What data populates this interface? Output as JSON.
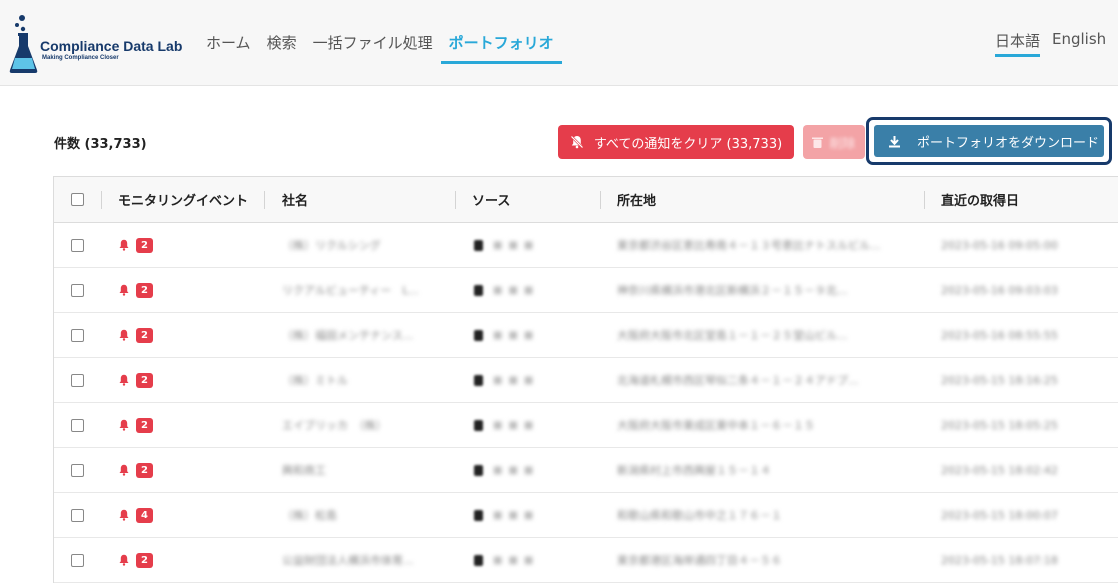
{
  "header": {
    "logo_title": "Compliance Data Lab",
    "logo_subtitle": "Making Compliance Closer",
    "nav": [
      "ホーム",
      "検索",
      "一括ファイル処理",
      "ポートフォリオ"
    ],
    "active_nav": "ポートフォリオ",
    "lang_ja": "日本語",
    "lang_en": "English"
  },
  "toolbar": {
    "count_label": "件数 (33,733)",
    "clear_button": "すべての通知をクリア (33,733)",
    "delete_button": "削除",
    "download_button": "ポートフォリオをダウンロード"
  },
  "table": {
    "headers": {
      "event": "モニタリングイベント",
      "company": "社名",
      "source": "ソース",
      "address": "所在地",
      "date": "直近の取得日"
    },
    "rows": [
      {
        "badge": "2",
        "company": "（株）リクルシング",
        "address": "東京都渋谷区恵比寿南４－１３号恵比ナトスルビル...",
        "date": "2023-05-16 09:05:00"
      },
      {
        "badge": "2",
        "company": "リクアルビューティー　L...",
        "address": "神奈川県横浜市港北区新横浜２－１５－９北...",
        "date": "2023-05-16 09:03:03"
      },
      {
        "badge": "2",
        "company": "（株）福田メンテナンス...",
        "address": "大阪府大阪市北区堂島１－１－２５堂山ビル...",
        "date": "2023-05-16 08:55:55"
      },
      {
        "badge": "2",
        "company": "（株）ミトル",
        "address": "北海道札幌市西区琴似二条４－１－２４アドプ...",
        "date": "2023-05-15 18:16:25"
      },
      {
        "badge": "2",
        "company": "エイブリッカ　（株）",
        "address": "大阪府大阪市東成区東中本１－６－１５",
        "date": "2023-05-15 18:05:25"
      },
      {
        "badge": "2",
        "company": "興和商工",
        "address": "新潟県村上市西興屋１５－１４",
        "date": "2023-05-15 18:02:42"
      },
      {
        "badge": "4",
        "company": "（株）松島",
        "address": "和歌山県和歌山市中之１７６－１",
        "date": "2023-05-15 18:00:07"
      },
      {
        "badge": "2",
        "company": "公益財団法人横浜市体育...",
        "address": "東京都港区海岸通四丁目４－５６",
        "date": "2023-05-15 18:07:18"
      }
    ]
  },
  "colors": {
    "accent": "#29a8d8",
    "danger": "#e53d4b",
    "download": "#3a7fa8",
    "logo": "#173a6b"
  }
}
